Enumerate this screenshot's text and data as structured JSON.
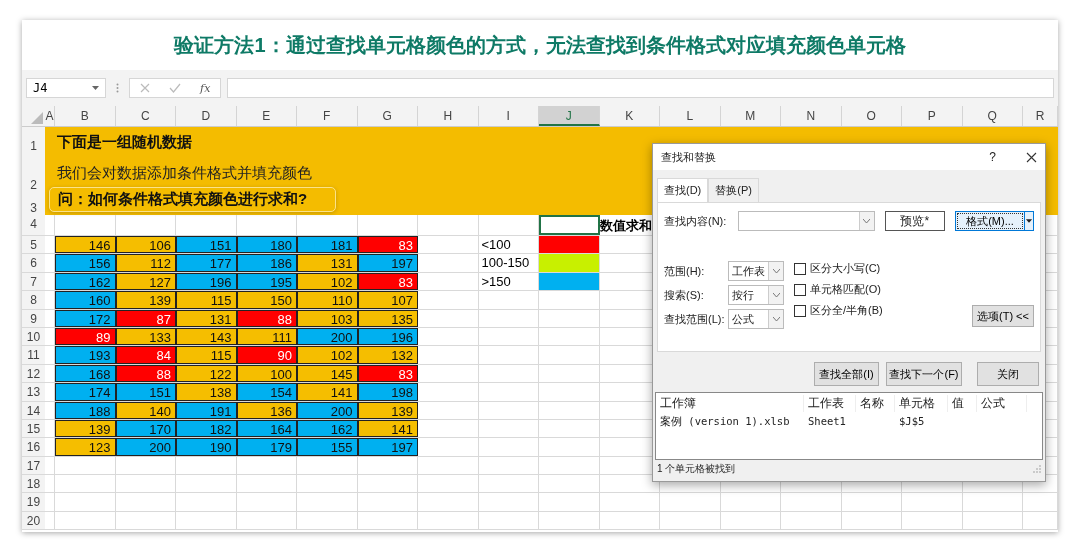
{
  "banner": {
    "title": "验证方法1：通过查找单元格颜色的方式，无法查找到条件格式对应填充颜色单元格"
  },
  "formula_bar": {
    "name_box": "J4",
    "function_label": "fx"
  },
  "columns": [
    {
      "label": "A",
      "selected": false
    },
    {
      "label": "B",
      "selected": false
    },
    {
      "label": "C",
      "selected": false
    },
    {
      "label": "D",
      "selected": false
    },
    {
      "label": "E",
      "selected": false
    },
    {
      "label": "F",
      "selected": false
    },
    {
      "label": "G",
      "selected": false
    },
    {
      "label": "H",
      "selected": false
    },
    {
      "label": "I",
      "selected": false
    },
    {
      "label": "J",
      "selected": true
    },
    {
      "label": "K",
      "selected": false
    },
    {
      "label": "L",
      "selected": false
    },
    {
      "label": "M",
      "selected": false
    },
    {
      "label": "N",
      "selected": false
    },
    {
      "label": "O",
      "selected": false
    },
    {
      "label": "P",
      "selected": false
    },
    {
      "label": "Q",
      "selected": false
    },
    {
      "label": "R",
      "selected": false
    }
  ],
  "row_numbers": [
    "1",
    "2",
    "3",
    "4",
    "5",
    "6",
    "7",
    "8",
    "9",
    "10",
    "11",
    "12",
    "13",
    "14",
    "15",
    "16",
    "17",
    "18",
    "19",
    "20"
  ],
  "notes": [
    {
      "kind": "heading",
      "text": "下面是一组随机数据"
    },
    {
      "kind": "plain",
      "text": "我们会对数据添加条件格式并填充颜色"
    },
    {
      "kind": "question",
      "text": "问：如何条件格式填充颜色进行求和?"
    }
  ],
  "sum_label": "数值求和",
  "data": [
    [
      {
        "value": "146",
        "color": "#f5be00"
      },
      {
        "value": "106",
        "color": "#f5be00"
      },
      {
        "value": "151",
        "color": "#00b0f0"
      },
      {
        "value": "180",
        "color": "#00b0f0"
      },
      {
        "value": "181",
        "color": "#00b0f0"
      },
      {
        "value": "83",
        "color": "#ff0000"
      }
    ],
    [
      {
        "value": "156",
        "color": "#00b0f0"
      },
      {
        "value": "112",
        "color": "#f5be00"
      },
      {
        "value": "177",
        "color": "#00b0f0"
      },
      {
        "value": "186",
        "color": "#00b0f0"
      },
      {
        "value": "131",
        "color": "#f5be00"
      },
      {
        "value": "197",
        "color": "#00b0f0"
      }
    ],
    [
      {
        "value": "162",
        "color": "#00b0f0"
      },
      {
        "value": "127",
        "color": "#f5be00"
      },
      {
        "value": "196",
        "color": "#00b0f0"
      },
      {
        "value": "195",
        "color": "#00b0f0"
      },
      {
        "value": "102",
        "color": "#f5be00"
      },
      {
        "value": "83",
        "color": "#ff0000"
      }
    ],
    [
      {
        "value": "160",
        "color": "#00b0f0"
      },
      {
        "value": "139",
        "color": "#f5be00"
      },
      {
        "value": "115",
        "color": "#f5be00"
      },
      {
        "value": "150",
        "color": "#f5be00"
      },
      {
        "value": "110",
        "color": "#f5be00"
      },
      {
        "value": "107",
        "color": "#f5be00"
      }
    ],
    [
      {
        "value": "172",
        "color": "#00b0f0"
      },
      {
        "value": "87",
        "color": "#ff0000"
      },
      {
        "value": "131",
        "color": "#f5be00"
      },
      {
        "value": "88",
        "color": "#ff0000"
      },
      {
        "value": "103",
        "color": "#f5be00"
      },
      {
        "value": "135",
        "color": "#f5be00"
      }
    ],
    [
      {
        "value": "89",
        "color": "#ff0000"
      },
      {
        "value": "133",
        "color": "#f5be00"
      },
      {
        "value": "143",
        "color": "#f5be00"
      },
      {
        "value": "111",
        "color": "#f5be00"
      },
      {
        "value": "200",
        "color": "#00b0f0"
      },
      {
        "value": "196",
        "color": "#00b0f0"
      }
    ],
    [
      {
        "value": "193",
        "color": "#00b0f0"
      },
      {
        "value": "84",
        "color": "#ff0000"
      },
      {
        "value": "115",
        "color": "#f5be00"
      },
      {
        "value": "90",
        "color": "#ff0000"
      },
      {
        "value": "102",
        "color": "#f5be00"
      },
      {
        "value": "132",
        "color": "#f5be00"
      }
    ],
    [
      {
        "value": "168",
        "color": "#00b0f0"
      },
      {
        "value": "88",
        "color": "#ff0000"
      },
      {
        "value": "122",
        "color": "#f5be00"
      },
      {
        "value": "100",
        "color": "#f5be00"
      },
      {
        "value": "145",
        "color": "#f5be00"
      },
      {
        "value": "83",
        "color": "#ff0000"
      }
    ],
    [
      {
        "value": "174",
        "color": "#00b0f0"
      },
      {
        "value": "151",
        "color": "#00b0f0"
      },
      {
        "value": "138",
        "color": "#f5be00"
      },
      {
        "value": "154",
        "color": "#00b0f0"
      },
      {
        "value": "141",
        "color": "#f5be00"
      },
      {
        "value": "198",
        "color": "#00b0f0"
      }
    ],
    [
      {
        "value": "188",
        "color": "#00b0f0"
      },
      {
        "value": "140",
        "color": "#f5be00"
      },
      {
        "value": "191",
        "color": "#00b0f0"
      },
      {
        "value": "136",
        "color": "#f5be00"
      },
      {
        "value": "200",
        "color": "#00b0f0"
      },
      {
        "value": "139",
        "color": "#f5be00"
      }
    ],
    [
      {
        "value": "139",
        "color": "#f5be00"
      },
      {
        "value": "170",
        "color": "#00b0f0"
      },
      {
        "value": "182",
        "color": "#00b0f0"
      },
      {
        "value": "164",
        "color": "#00b0f0"
      },
      {
        "value": "162",
        "color": "#00b0f0"
      },
      {
        "value": "141",
        "color": "#f5be00"
      }
    ],
    [
      {
        "value": "123",
        "color": "#f5be00"
      },
      {
        "value": "200",
        "color": "#00b0f0"
      },
      {
        "value": "190",
        "color": "#00b0f0"
      },
      {
        "value": "179",
        "color": "#00b0f0"
      },
      {
        "value": "155",
        "color": "#00b0f0"
      },
      {
        "value": "197",
        "color": "#00b0f0"
      }
    ]
  ],
  "legend": [
    {
      "label": "<100",
      "color": "#ff0000"
    },
    {
      "label": "100-150",
      "color": "#c8f000"
    },
    {
      "label": ">150",
      "color": "#00b0f0"
    }
  ],
  "dialog": {
    "title": "查找和替换",
    "help": "?",
    "tabs": [
      {
        "label": "查找(D)",
        "selected": true
      },
      {
        "label": "替换(P)",
        "selected": false
      }
    ],
    "find_label": "查找内容(N):",
    "preview": "预览*",
    "format_button": "格式(M)...",
    "selects": [
      {
        "label": "范围(H):",
        "value": "工作表"
      },
      {
        "label": "搜索(S):",
        "value": "按行"
      },
      {
        "label": "查找范围(L):",
        "value": "公式"
      }
    ],
    "checkboxes": [
      {
        "label": "区分大小写(C)",
        "checked": false
      },
      {
        "label": "单元格匹配(O)",
        "checked": false
      },
      {
        "label": "区分全/半角(B)",
        "checked": false
      }
    ],
    "options_button": "选项(T) <<",
    "buttons": [
      "查找全部(I)",
      "查找下一个(F)",
      "关闭"
    ],
    "result_columns": [
      "工作簿",
      "工作表",
      "名称",
      "单元格",
      "值",
      "公式"
    ],
    "results": [
      {
        "workbook": "案例 (version 1).xlsb",
        "sheet": "Sheet1",
        "cell": "$J$5"
      }
    ],
    "status": "1 个单元格被找到"
  }
}
